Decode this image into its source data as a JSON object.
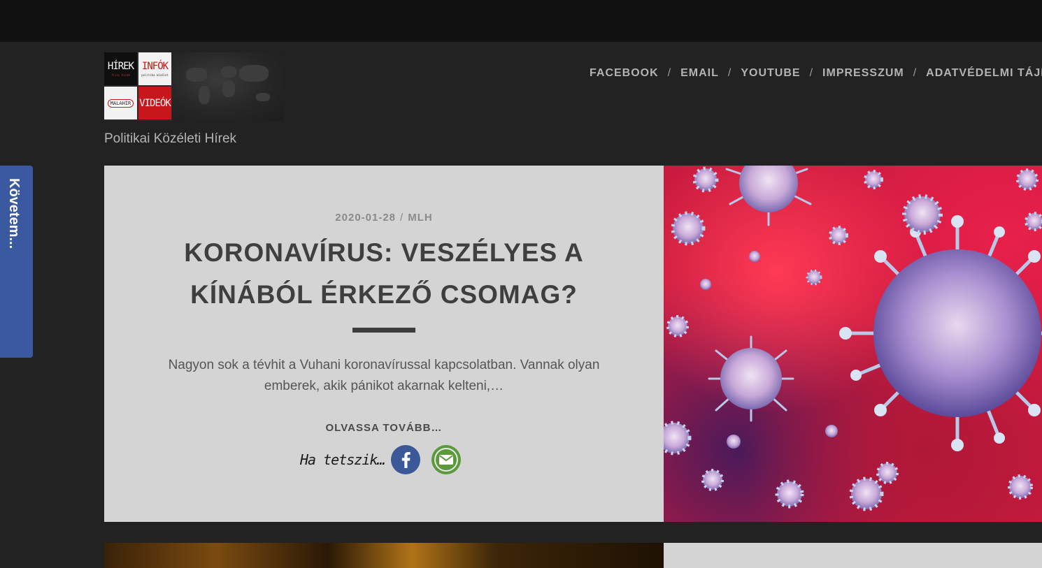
{
  "logo": {
    "tiles": [
      {
        "text": "HÍREK",
        "sub": "friss hírek"
      },
      {
        "text": "INFÓK",
        "sub": "politika közélet"
      },
      {
        "text": "MALAHÍR"
      },
      {
        "text": "VIDEÓK"
      }
    ]
  },
  "site": {
    "tagline": "Politikai Közéleti Hírek"
  },
  "nav": {
    "items": [
      "FACEBOOK",
      "EMAIL",
      "YOUTUBE",
      "IMPRESSZUM",
      "ADATVÉDELMI TÁJÉ"
    ],
    "separator": "/"
  },
  "follow_tab": {
    "label": "Követem..."
  },
  "post": {
    "date": "2020-01-28",
    "meta_sep": "/",
    "author": "MLH",
    "title": "KORONAVÍRUS: VESZÉLYES A KÍNÁBÓL ÉRKEZŐ CSOMAG?",
    "excerpt": "Nagyon sok a tévhit a Vuhani koronavírussal kapcsolatban. Vannak olyan emberek, akik pánikot akarnak kelteni,…",
    "read_more": "OLVASSA TOVÁBB…",
    "share_label": "Ha tetszik…",
    "share_icons": [
      "facebook-icon",
      "email-icon"
    ]
  },
  "colors": {
    "background": "#222222",
    "topbar": "#111111",
    "card": "#d4d4d4",
    "follow_tab": "#3b59a0",
    "facebook": "#3b5998",
    "email": "#5a9a3a"
  }
}
